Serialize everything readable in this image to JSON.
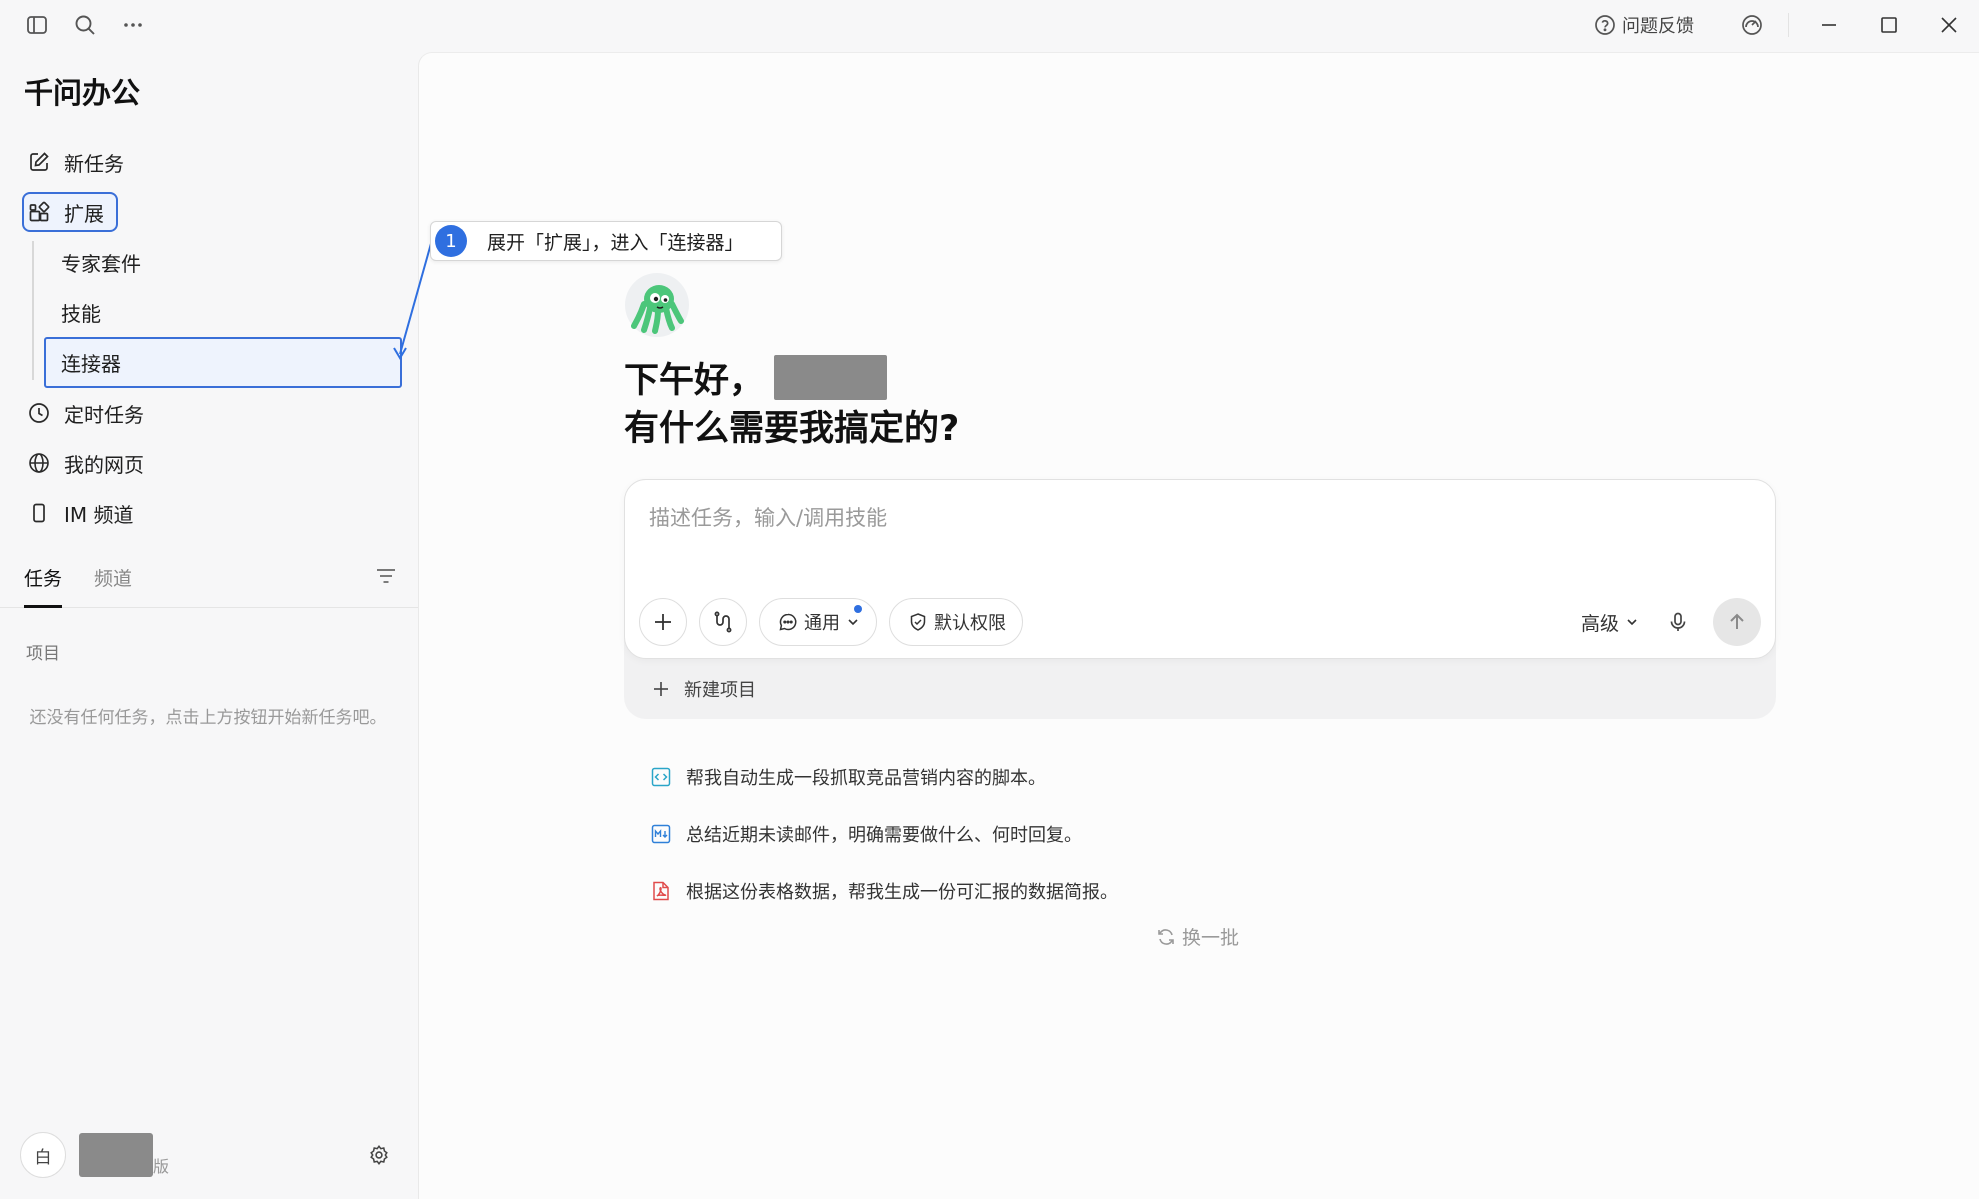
{
  "topbar": {
    "feedback_label": "问题反馈"
  },
  "sidebar": {
    "app_title": "千问办公",
    "nav": [
      {
        "label": "新任务",
        "icon": "edit-icon"
      },
      {
        "label": "扩展",
        "icon": "extensions-icon"
      },
      {
        "label": "定时任务",
        "icon": "clock-icon"
      },
      {
        "label": "我的网页",
        "icon": "globe-icon"
      },
      {
        "label": "IM 频道",
        "icon": "phone-icon"
      }
    ],
    "subnav": [
      {
        "label": "专家套件"
      },
      {
        "label": "技能"
      },
      {
        "label": "连接器"
      }
    ],
    "tabs": [
      {
        "label": "任务",
        "active": true
      },
      {
        "label": "频道",
        "active": false
      }
    ],
    "section_label": "项目",
    "empty_text": "还没有任何任务，点击上方按钮开始新任务吧。",
    "user": {
      "avatar_text": "白",
      "edition_suffix": "版"
    }
  },
  "callout": {
    "number": "1",
    "text": "展开「扩展」，进入「连接器」"
  },
  "main": {
    "greeting_line1": "下午好，",
    "greeting_line2": "有什么需要我搞定的?",
    "composer": {
      "placeholder": "描述任务，输入/调用技能",
      "mode_label": "通用",
      "permission_label": "默认权限",
      "advanced_label": "高级",
      "new_project_label": "新建项目"
    },
    "suggestions": [
      {
        "text": "帮我自动生成一段抓取竞品营销内容的脚本。",
        "icon": "code-file-icon",
        "color": "#2aa5c8"
      },
      {
        "text": "总结近期未读邮件，明确需要做什么、何时回复。",
        "icon": "markdown-file-icon",
        "color": "#2f80d8"
      },
      {
        "text": "根据这份表格数据，帮我生成一份可汇报的数据简报。",
        "icon": "pdf-file-icon",
        "color": "#e04b4b"
      }
    ],
    "refresh_label": "换一批"
  },
  "colors": {
    "accent": "#2f6fe0",
    "highlight_border": "#3a6fd8",
    "mascot_green": "#4cc67a"
  }
}
